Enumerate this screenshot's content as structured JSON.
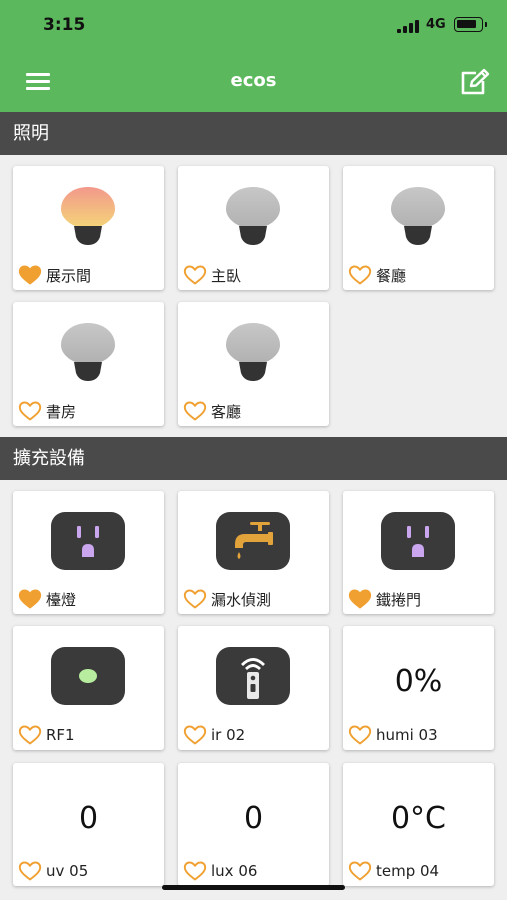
{
  "status": {
    "time": "3:15",
    "network": "4G"
  },
  "nav": {
    "title": "ecos"
  },
  "sections": {
    "lighting": "照明",
    "expansion": "擴充設備"
  },
  "lights": [
    {
      "label": "展示間",
      "favorite": true,
      "state": "on"
    },
    {
      "label": "主臥",
      "favorite": false,
      "state": "off"
    },
    {
      "label": "餐廳",
      "favorite": false,
      "state": "off"
    },
    {
      "label": "書房",
      "favorite": false,
      "state": "off"
    },
    {
      "label": "客廳",
      "favorite": false,
      "state": "off"
    }
  ],
  "devices": [
    {
      "label": "檯燈",
      "favorite": true,
      "icon": "outlet-icon"
    },
    {
      "label": "漏水偵測",
      "favorite": false,
      "icon": "faucet-icon"
    },
    {
      "label": "鐵捲門",
      "favorite": true,
      "icon": "outlet-icon"
    },
    {
      "label": "RF1",
      "favorite": false,
      "icon": "rf-dot-icon"
    },
    {
      "label": "ir 02",
      "favorite": false,
      "icon": "remote-icon"
    },
    {
      "label": "humi 03",
      "favorite": false,
      "value": "0%"
    },
    {
      "label": "uv 05",
      "favorite": false,
      "value": "0"
    },
    {
      "label": "lux 06",
      "favorite": false,
      "value": "0"
    },
    {
      "label": "temp 04",
      "favorite": false,
      "value": "0°C"
    }
  ],
  "colors": {
    "accent": "#5cb85c",
    "section": "#4a4a4a",
    "heart": "#f0a030",
    "tile": "#3a3a3a",
    "outlet": "#c9a6ee",
    "faucet": "#e2a33a",
    "rf_dot": "#b8ec9e"
  }
}
